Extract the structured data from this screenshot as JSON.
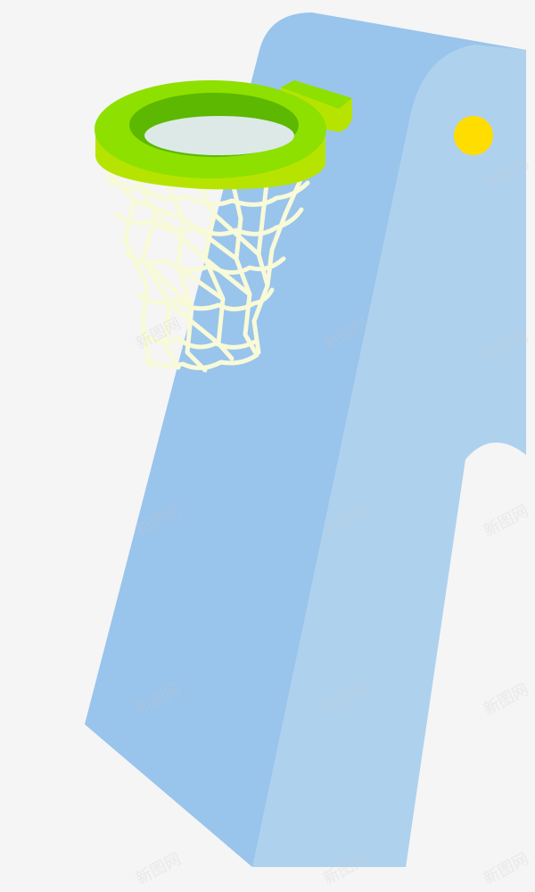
{
  "colors": {
    "background": "#f5f5f5",
    "post_front": "#99c4ec",
    "post_side": "#aed1ee",
    "rim_top": "#8ee000",
    "rim_side": "#b6e400",
    "rim_inner": "#5cb800",
    "rim_hole": "#dde9e6",
    "net": "#f8fad8",
    "light": "#ffdd00"
  },
  "icons": {
    "post": "backboard-post",
    "rim": "basketball-rim",
    "net": "basketball-net",
    "light": "yellow-light-dot"
  },
  "watermark": {
    "text": "新图网"
  }
}
